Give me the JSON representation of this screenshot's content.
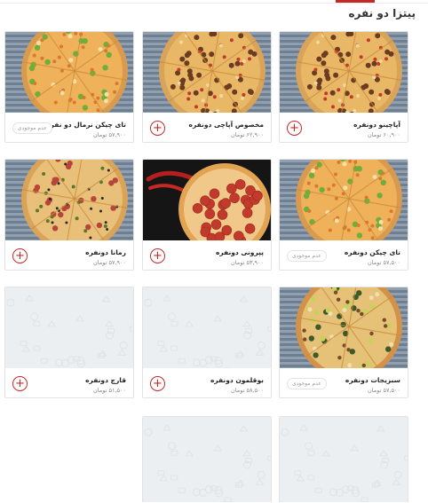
{
  "section": {
    "title": "پیتزا دو نفره"
  },
  "colors": {
    "accent": "#c62828",
    "placeholder_bg": "#eceff2"
  },
  "labels": {
    "unavailable": "عدم موجودی"
  },
  "products": [
    {
      "name": "آپاچینو دونفره",
      "price": "۶۰,۹۰۰ تومان",
      "status": "add",
      "image": "pizza-beef"
    },
    {
      "name": "مخصوص آپاچی دونفره",
      "price": "۶۲,۹۰۰ تومان",
      "status": "add",
      "image": "pizza-beef"
    },
    {
      "name": "تای چیکن نرمال دو نفره",
      "price": "۵۷,۹۰۰ تومان",
      "status": "unavailable",
      "image": "pizza-chicken"
    },
    {
      "name": "تای چیکن دونفره",
      "price": "۵۷,۵۰۰ تومان",
      "status": "unavailable",
      "image": "pizza-chicken"
    },
    {
      "name": "پپرونی دونفره",
      "price": "۵۳,۹۰۰ تومان",
      "status": "add",
      "image": "pizza-pepperoni"
    },
    {
      "name": "رمانا دونفره",
      "price": "۵۷,۹۰۰ تومان",
      "status": "add",
      "image": "pizza-salami"
    },
    {
      "name": "سبزیجات دونفره",
      "price": "۵۷,۵۰۰ تومان",
      "status": "unavailable",
      "image": "pizza-veggie"
    },
    {
      "name": "بوقلمون دونفره",
      "price": "۵۸,۵۰۰ تومان",
      "status": "add",
      "image": "placeholder"
    },
    {
      "name": "قارچ دونفره",
      "price": "۵۱,۵۰۰ تومان",
      "status": "add",
      "image": "placeholder"
    },
    {
      "name": "",
      "price": "",
      "status": "",
      "image": "placeholder"
    },
    {
      "name": "",
      "price": "",
      "status": "",
      "image": "placeholder"
    }
  ]
}
